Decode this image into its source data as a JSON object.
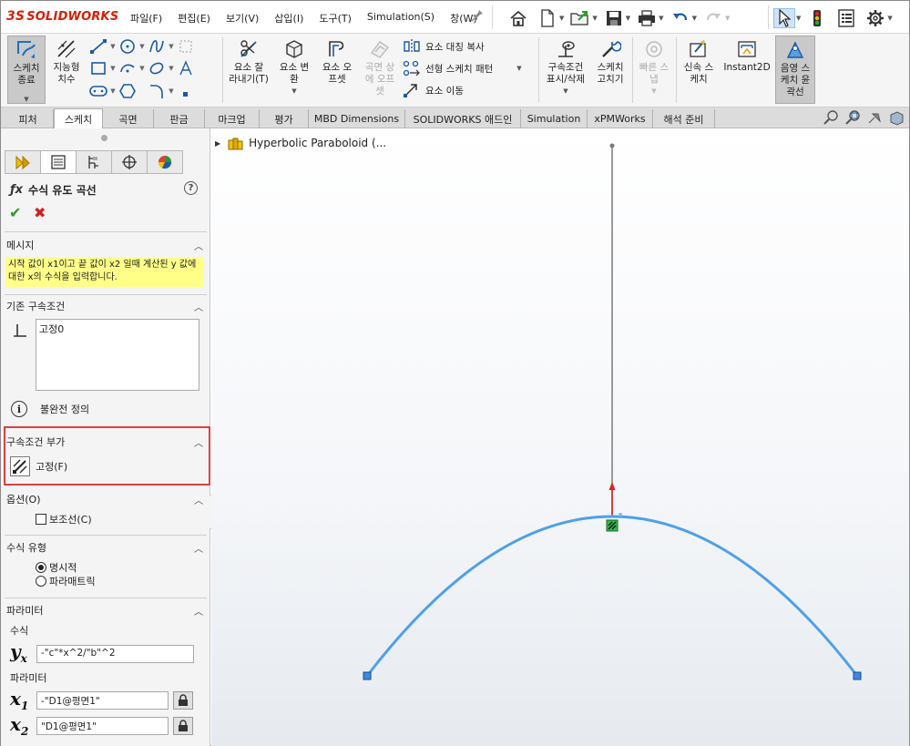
{
  "app": {
    "logo_text": "SOLIDWORKS",
    "menu": [
      "파일(F)",
      "편집(E)",
      "보기(V)",
      "삽입(I)",
      "도구(T)",
      "Simulation(S)",
      "창(W)"
    ]
  },
  "ribbon": {
    "exit_sketch": "스케치\n종료",
    "smart_dim": "지능형\n치수",
    "trim": "요소 잘\n라내기(T)",
    "convert": "요소 변\n환",
    "offset": "요소 오\n프셋",
    "offset_surface": "곡면 상\n에 오프\n셋",
    "mirror": "요소 대칭 복사",
    "linear_pattern": "선형 스케치 패턴",
    "move": "요소 이동",
    "display_relations": "구속조건\n표시/삭제",
    "repair": "스케치\n고치기",
    "quick_snap": "빠른 스\n냅",
    "rapid_sketch": "신속 스\n케치",
    "instant2d": "Instant2D",
    "shaded_contours": "음영 스\n케치 윤\n곽선"
  },
  "tabs": [
    "피처",
    "스케치",
    "곡면",
    "판금",
    "마크업",
    "평가",
    "MBD Dimensions",
    "SOLIDWORKS 애드인",
    "Simulation",
    "xPMWorks",
    "해석 준비"
  ],
  "active_tab": "스케치",
  "panel": {
    "title": "수식 유도 곡선",
    "message_header": "메시지",
    "message_text": "시작 값이 x1이고 끝 값이 x2 일때 계산된 y 값에 대한 x의 수식을 입력합니다.",
    "existing_relations_header": "기존 구속조건",
    "existing_relations_item": "고정0",
    "status_text": "불완전 정의",
    "add_relations_header": "구속조건 부가",
    "fix_label": "고정(F)",
    "options_header": "옵션(O)",
    "construction_label": "보조선(C)",
    "equation_type_header": "수식 유형",
    "explicit_label": "명시적",
    "parametric_label": "파라매트릭",
    "parameters_header": "파라미터",
    "equation_label": "수식",
    "equation_value": "-\"c\"*x^2/\"b\"^2",
    "params_label": "파라미터",
    "x1_value": "-\"D1@평면1\"",
    "x2_value": "\"D1@평면1\"",
    "explicit_selected": true,
    "construction_checked": false
  },
  "graphics": {
    "tree_item": "Hyperbolic Paraboloid (..."
  }
}
